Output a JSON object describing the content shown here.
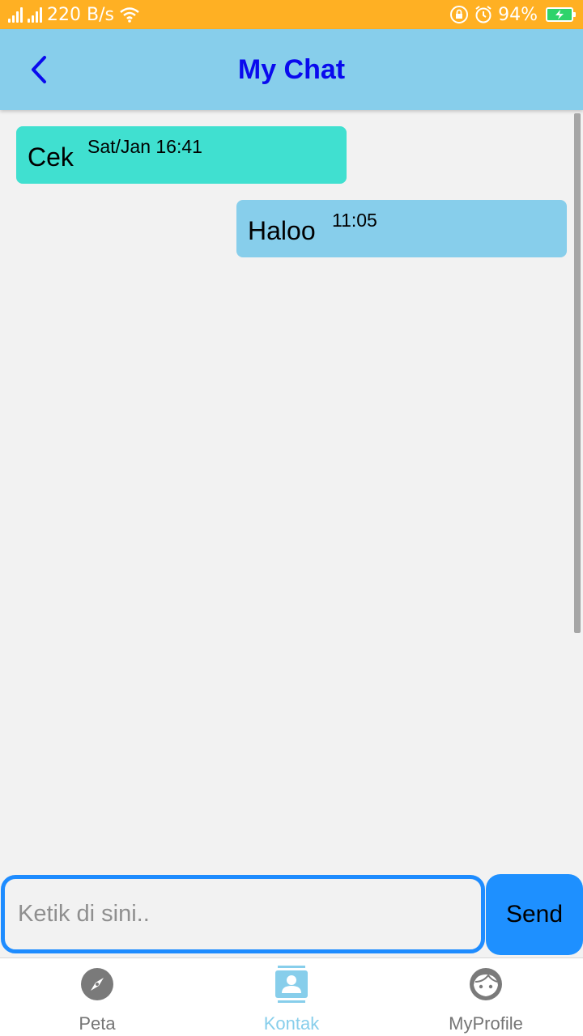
{
  "status_bar": {
    "network_speed": "220 B/s",
    "battery_percent": "94%",
    "icons": [
      "signal-icon",
      "signal-icon",
      "wifi-icon",
      "rotation-lock-icon",
      "alarm-icon",
      "battery-charging-icon"
    ]
  },
  "app_bar": {
    "title": "My Chat",
    "back_icon": "chevron-left-icon"
  },
  "messages": [
    {
      "text": "Cek",
      "time": "Sat/Jan 16:41",
      "direction": "incoming",
      "color": "#40e0d0"
    },
    {
      "text": "Haloo",
      "time": "11:05",
      "direction": "outgoing",
      "color": "#87ceeb"
    }
  ],
  "composer": {
    "placeholder": "Ketik di sini..",
    "value": "",
    "send_label": "Send"
  },
  "bottom_nav": {
    "items": [
      {
        "label": "Peta",
        "icon": "compass-icon",
        "active": false
      },
      {
        "label": "Kontak",
        "icon": "contact-icon",
        "active": true
      },
      {
        "label": "MyProfile",
        "icon": "face-icon",
        "active": false
      }
    ]
  },
  "colors": {
    "status_bar": "#ffb023",
    "app_bar": "#87ceeb",
    "title": "#0a0aee",
    "accent": "#1e90ff",
    "incoming_bubble": "#40e0d0",
    "outgoing_bubble": "#87ceeb"
  }
}
